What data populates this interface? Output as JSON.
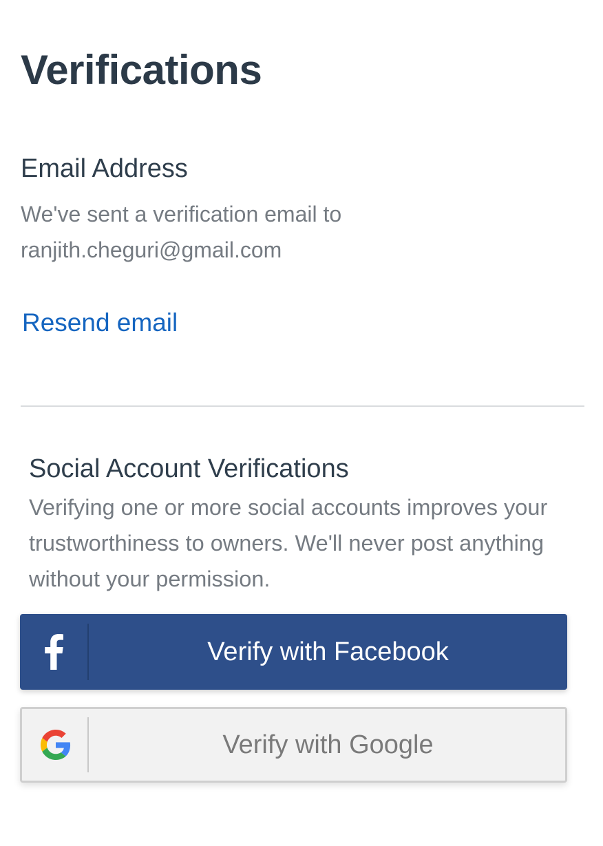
{
  "page": {
    "title": "Verifications"
  },
  "email_section": {
    "heading": "Email Address",
    "description_line1": "We've sent a verification email to",
    "email": "ranjith.cheguri@gmail.com",
    "resend_label": "Resend email"
  },
  "social_section": {
    "heading": "Social Account Verifications",
    "description": "Verifying one or more social accounts improves your trustworthiness to owners. We'll never post anything without your permission.",
    "buttons": [
      {
        "label": "Verify with Facebook",
        "icon": "facebook-icon",
        "bg": "#2e4f8a",
        "text_color": "#ffffff"
      },
      {
        "label": "Verify with Google",
        "icon": "google-icon",
        "bg": "#f2f2f2",
        "text_color": "#7a7a7a"
      }
    ]
  },
  "colors": {
    "link": "#1565c0",
    "heading": "#2c3a48",
    "muted_text": "#757b82",
    "divider": "#d9dbde"
  }
}
